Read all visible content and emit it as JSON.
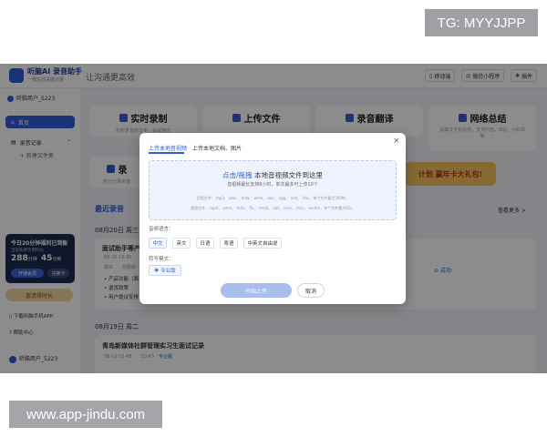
{
  "watermark": {
    "top_right": "TG: MYYJJPP",
    "bottom_left": "www.app-jindu.com"
  },
  "app": {
    "brand": "听脑AI 录音助手",
    "brand_sub": "一键生成关键记录",
    "slogan": "让沟通更高效",
    "topbar_buttons": [
      "移动端",
      "微信小程序",
      "插件"
    ]
  },
  "sidebar": {
    "user": "听脑用户_5223",
    "items": [
      {
        "label": "首页",
        "active": true
      },
      {
        "label": "录音记录",
        "active": false
      },
      {
        "label": "+ 新建文件夹",
        "active": false
      }
    ],
    "promo": {
      "title": "今日20分钟福利已到账",
      "subtitle": "当前免费可用时长",
      "minutes": "288",
      "minutes_unit": "分钟",
      "extra": "45",
      "extra_unit": "分钟",
      "vip_button": "开通会员",
      "redeem": "兑换卡"
    },
    "invite": "邀请得时长",
    "download": "下载听脑手机APP",
    "help": "帮助中心",
    "bottom_user": "听脑用户_5223"
  },
  "main": {
    "cards": [
      {
        "title": "实时录制",
        "desc": "实时录音转文字，会议速记",
        "icon_color": "#2f5fd8"
      },
      {
        "title": "上传文件",
        "desc": "",
        "icon_color": "#2f5fd8"
      },
      {
        "title": "录音翻译",
        "desc": "",
        "icon_color": "#2f5fd8"
      },
      {
        "title": "网络总结",
        "desc": "提取文字并总结，支持抖音、B站、小红书等",
        "icon_color": "#2f5fd8"
      }
    ],
    "card_row2_left": {
      "title": "录",
      "desc": "自己记录关键"
    },
    "banner_text": "计划 赢年卡大礼包!",
    "recent_label": "最近录音",
    "more_label": "查看更多 >",
    "date1": "08月20日 周三",
    "rec1_title": "面试助手等产品",
    "rec1_meta": "08-20 16:30",
    "rec1_bullets": [
      "产品功能（面",
      "退货政策",
      "用户提议安排"
    ],
    "rec1_tags": [
      "脚本",
      "简要版"
    ],
    "success_label": "成功",
    "date2": "08月19日 周二",
    "rec2_title": "青岛新媒体社群管理实习生面试记录",
    "rec2_meta": "08-19 10:48",
    "rec2_duration": "20:43",
    "rec2_tag": "专业版"
  },
  "modal": {
    "tabs": [
      "上传本地音视频",
      "上传本地文档、图片"
    ],
    "close": "×",
    "drop_title_link": "点击/拖拽",
    "drop_title_rest": " 本地音视频文件到这里",
    "drop_sub": "音视频最长支持6小时，单次最多可上传10个",
    "formats_audio": "音频文件：.mp3、.wav、.m4a、.wma、.aac、.ogg、.amr、.flac，单个文件最大500M。",
    "formats_video": "视频文件：.mp4、.wmv、.m4v、.flv、.rmvb、.dat、.mov、.mkv、.webm，单个文件最大6G。",
    "lang_label": "音频语言：",
    "languages": [
      {
        "label": "中文",
        "selected": true
      },
      {
        "label": "英文",
        "selected": false
      },
      {
        "label": "日语",
        "selected": false
      },
      {
        "label": "粤语",
        "selected": false
      },
      {
        "label": "中英文自由说",
        "selected": false
      }
    ],
    "mode_label": "转写模式：",
    "mode_value": "专业版",
    "start_button": "开始上传",
    "cancel_button": "取消"
  },
  "colors": {
    "accent": "#2f5fd8",
    "overlay": "rgba(0,0,0,0.45)"
  }
}
